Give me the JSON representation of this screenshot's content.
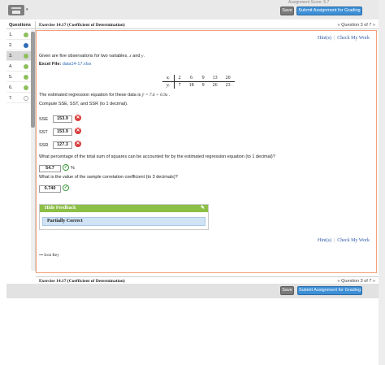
{
  "topbar": {
    "crumb": "Assignment Score: 5.7",
    "save_label": "Save",
    "submit_label": "Submit Assignment for Grading"
  },
  "sidebar": {
    "header": "Questions",
    "items": [
      {
        "label": "1.",
        "status": "complete"
      },
      {
        "label": "2.",
        "status": "current"
      },
      {
        "label": "3.",
        "status": "complete"
      },
      {
        "label": "4.",
        "status": "complete"
      },
      {
        "label": "5.",
        "status": "complete"
      },
      {
        "label": "6.",
        "status": "complete"
      },
      {
        "label": "7.",
        "status": "unanswered"
      }
    ]
  },
  "exercise": {
    "title": "Exercise 14.17 (Coefficient of Determination)",
    "nav": "« Question 3 of 7 »",
    "hint_label": "Hint(s)",
    "check_label": "Check My Work",
    "intro_prefix": "Given are five observations for two variables,",
    "var_x": "x",
    "and_word": "and",
    "var_y": "y",
    "intro_suffix": ".",
    "excel_label": "Excel File:",
    "excel_link": "data14-17.xlsx",
    "table": {
      "x_label": "xᵢ",
      "y_label": "yᵢ",
      "x_values": [
        "2",
        "6",
        "9",
        "13",
        "20"
      ],
      "y_values": [
        "7",
        "18",
        "9",
        "26",
        "23"
      ]
    },
    "equation_prefix": "The estimated regression equation for these data is",
    "equation": "ŷ = 7.6 + 0.9x",
    "equation_suffix": ".",
    "compute_prompt_pre": "Compute SSE, SST, and SSR (to",
    "compute_prompt_num": "1",
    "compute_prompt_post": "decimal).",
    "fields": [
      {
        "label": "SSE",
        "value": "153.9",
        "status": "incorrect"
      },
      {
        "label": "SST",
        "value": "153.9",
        "status": "incorrect"
      },
      {
        "label": "SSR",
        "value": "127.3",
        "status": "incorrect"
      }
    ],
    "pct_question_pre": "What percentage of the total sum of squares can be accounted for by the estimated regression equation (to",
    "pct_question_num": "1",
    "pct_question_post": "decimal)?",
    "pct_value": "54.7",
    "pct_unit": "%",
    "r_question_pre": "What is the value of the sample correlation coefficient (to",
    "r_question_num": "3",
    "r_question_post": "decimals)?",
    "r_value": "0.740",
    "feedback_header": "Hide Feedback",
    "feedback_text": "Partially Correct",
    "hint_label_2": "Hint(s)",
    "check_label_2": "Check My Work",
    "icon_key": "Icon Key"
  },
  "colors": {
    "accent_blue": "#3d8fd6",
    "feedback_green": "#8cbf46",
    "error_red": "#d93a3a",
    "ok_green": "#3c9a3c",
    "frame_orange": "#f2a07a"
  }
}
